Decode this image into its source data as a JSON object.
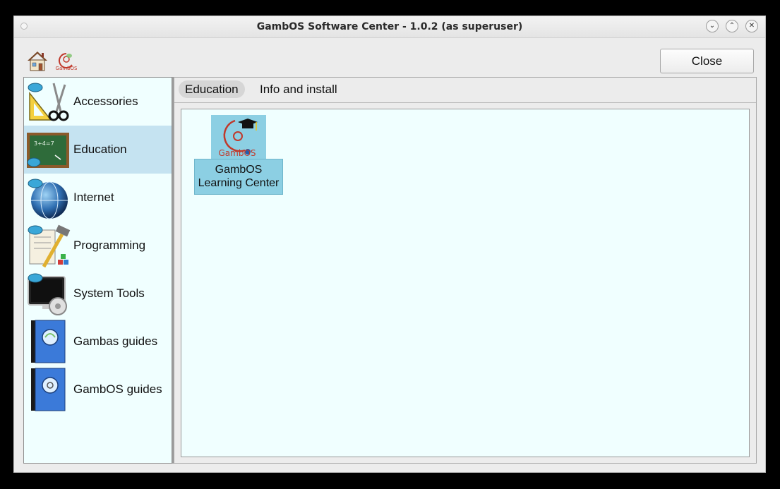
{
  "window": {
    "title": "GambOS Software Center - 1.0.2 (as superuser)",
    "controls": {
      "minimize": "⌄",
      "maximize": "⌃",
      "close": "✕"
    }
  },
  "toolbar": {
    "icons": [
      "home-icon",
      "gambos-logo-icon"
    ],
    "logo_text": "GambOS",
    "close_label": "Close"
  },
  "sidebar": {
    "items": [
      {
        "label": "Accessories",
        "icon": "accessories-icon",
        "selected": false
      },
      {
        "label": "Education",
        "icon": "education-icon",
        "selected": true
      },
      {
        "label": "Internet",
        "icon": "internet-icon",
        "selected": false
      },
      {
        "label": "Programming",
        "icon": "programming-icon",
        "selected": false
      },
      {
        "label": "System Tools",
        "icon": "system-tools-icon",
        "selected": false
      },
      {
        "label": "Gambas guides",
        "icon": "gambas-guides-icon",
        "selected": false
      },
      {
        "label": "GambOS guides",
        "icon": "gambos-guides-icon",
        "selected": false
      }
    ]
  },
  "tabs": [
    {
      "label": "Education",
      "active": true
    },
    {
      "label": "Info and install",
      "active": false
    }
  ],
  "apps": [
    {
      "name_line1": "GambOS",
      "name_line2": "Learning Center",
      "icon_text": "GambOS",
      "icon": "gambos-learning-center-icon"
    }
  ],
  "colors": {
    "selection": "#c5e3f1",
    "panel_bg": "#f0ffff",
    "app_highlight": "#8ccfe3",
    "gambos_red": "#c0392b"
  }
}
